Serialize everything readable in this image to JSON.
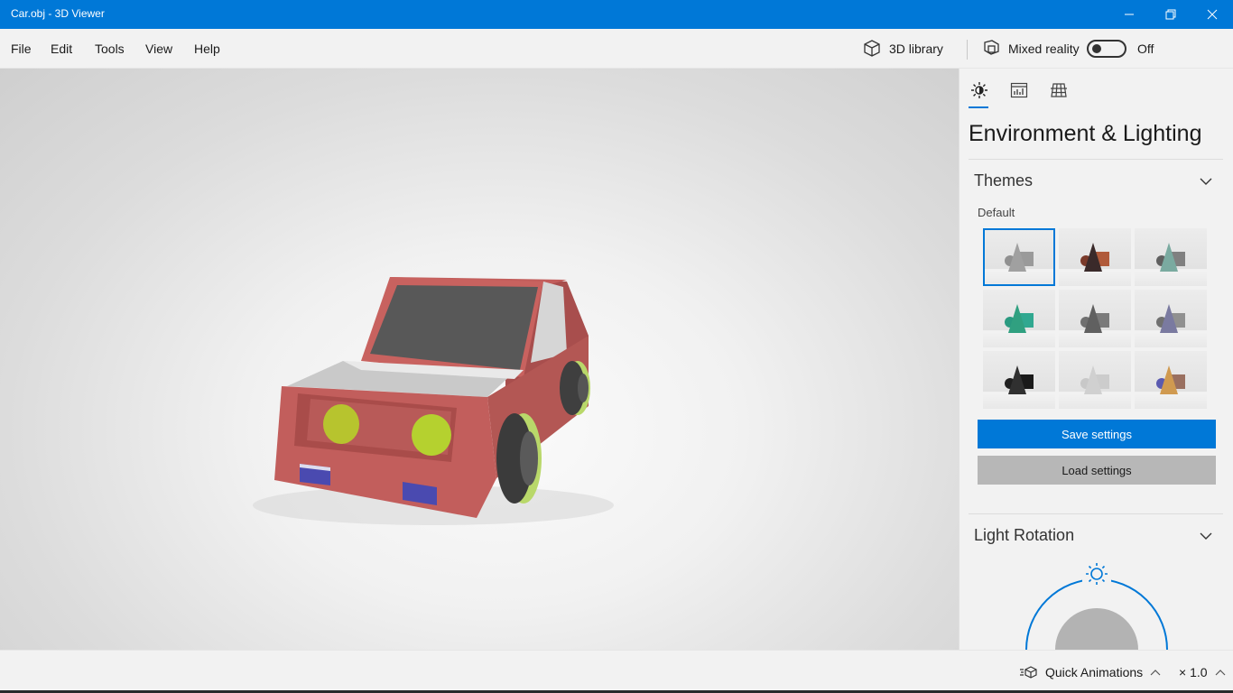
{
  "window": {
    "title": "Car.obj - 3D Viewer",
    "accent": "#0078d7"
  },
  "menu": {
    "items": [
      {
        "label": "File"
      },
      {
        "label": "Edit"
      },
      {
        "label": "Tools"
      },
      {
        "label": "View"
      },
      {
        "label": "Help"
      }
    ],
    "library_label": "3D library",
    "library_icon": "cube-icon",
    "mixed_reality_label": "Mixed reality",
    "mixed_reality_icon": "mixed-reality-icon",
    "mixed_reality_state": "Off"
  },
  "viewport": {
    "model": "car",
    "model_colors": {
      "body": "#b85a58",
      "window": "#5a5a5a",
      "headlight": "#b7cc2e",
      "plate": "#4b4bb0",
      "wheel_rim": "#b9d86a"
    }
  },
  "panel": {
    "tabs": [
      {
        "icon": "sun-icon",
        "selected": true
      },
      {
        "icon": "stats-icon",
        "selected": false
      },
      {
        "icon": "grid-icon",
        "selected": false
      }
    ],
    "title": "Environment & Lighting",
    "themes": {
      "heading": "Themes",
      "selected_label": "Default",
      "options": [
        {
          "colors": [
            "#909090",
            "#a0a0a0",
            "#9a9a9a"
          ],
          "selected": true
        },
        {
          "colors": [
            "#7a3a2a",
            "#3a2a2a",
            "#b05a3a"
          ],
          "selected": false
        },
        {
          "colors": [
            "#606060",
            "#7aaaa0",
            "#808080"
          ],
          "selected": false
        },
        {
          "colors": [
            "#2a9a80",
            "#30a080",
            "#30a890"
          ],
          "selected": false
        },
        {
          "colors": [
            "#707070",
            "#606060",
            "#7a7a7a"
          ],
          "selected": false
        },
        {
          "colors": [
            "#707070",
            "#7a7aa0",
            "#909090"
          ],
          "selected": false
        },
        {
          "colors": [
            "#202020",
            "#303030",
            "#1a1a1a"
          ],
          "selected": false
        },
        {
          "colors": [
            "#c8c8c8",
            "#d0d0d0",
            "#cccccc"
          ],
          "selected": false
        },
        {
          "colors": [
            "#5a5ab0",
            "#d09a50",
            "#9a7060"
          ],
          "selected": false
        }
      ]
    },
    "save_label": "Save settings",
    "load_label": "Load settings",
    "light_rotation": {
      "heading": "Light Rotation"
    }
  },
  "status": {
    "quick_animations_label": "Quick Animations",
    "speed": "× 1.0"
  }
}
